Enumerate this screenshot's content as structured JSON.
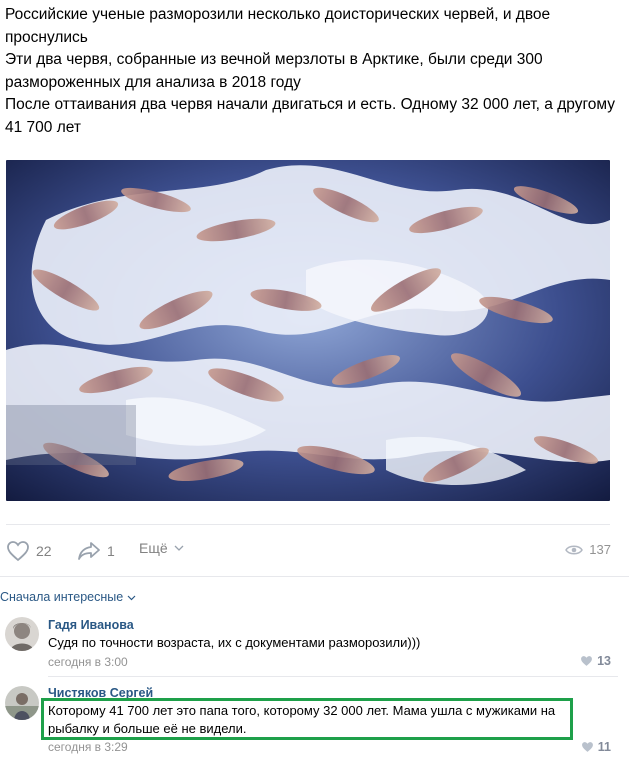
{
  "post": {
    "lines": [
      "Российские ученые разморозили несколько доисторических червей, и двое проснулись",
      "Эти два червя, собранные из вечной мерзлоты в Арктике, были среди 300 размороженных для анализа в 2018 году",
      "После оттаивания два червя начали двигаться и есть. Одному 32 000 лет, а другому 41 700 лет"
    ]
  },
  "actions": {
    "likes": "22",
    "shares": "1",
    "more_label": "Ещё",
    "views": "137"
  },
  "comments_sort": "Сначала интересные",
  "comments": [
    {
      "author": "Гадя Иванова",
      "text": "Судя по точности возраста, их с документами разморозили)))",
      "date": "сегодня в 3:00",
      "likes": "13"
    },
    {
      "author": "Чистяков Сергей",
      "text": "Которому 41 700 лет это папа того, которому 32 000 лет. Мама ушла с мужиками на рыбалку и больше её не видели.",
      "date": "сегодня в 3:29",
      "likes": "11"
    }
  ],
  "colors": {
    "link": "#2a5885",
    "highlight_border": "#1ea04a",
    "muted": "#939393"
  }
}
